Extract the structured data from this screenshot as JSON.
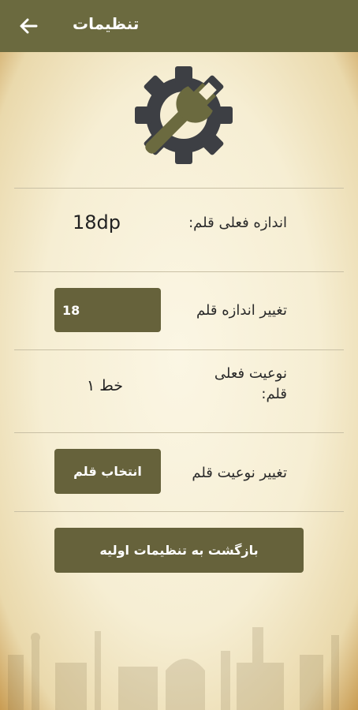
{
  "header": {
    "title": "تنظیمات"
  },
  "settings": {
    "current_size_label": "اندازه فعلی قلم:",
    "current_size_value": "18dp",
    "change_size_label": "تغییر اندازه قلم",
    "size_input_value": "18",
    "current_font_label": "نوعیت فعلی قلم:",
    "current_font_value": "خط ۱",
    "change_font_label": "تغییر نوعیت قلم",
    "choose_font_button": "انتخاب قلم",
    "reset_button": "بازگشت به تنظیمات اولیه"
  },
  "colors": {
    "appbar": "#6b6a3f",
    "button": "#66623b",
    "gear": "#3d3f44",
    "wrench": "#6b6a3f"
  },
  "icons": {
    "back": "arrow-left-icon",
    "logo": "gear-wrench-icon"
  }
}
